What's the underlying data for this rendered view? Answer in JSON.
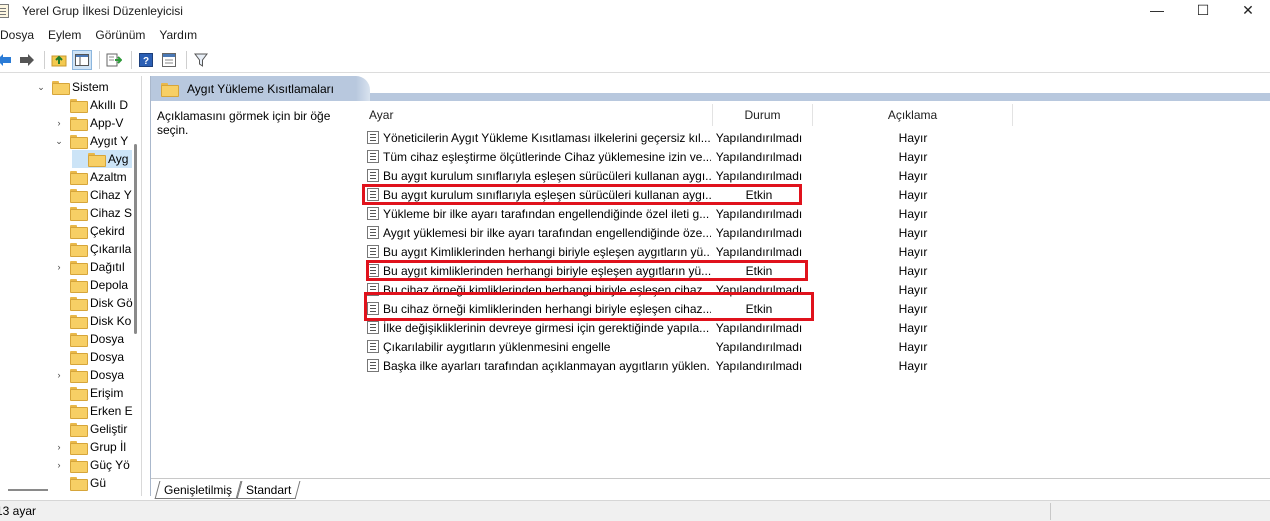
{
  "window": {
    "title": "Yerel Grup İlkesi Düzenleyicisi",
    "controls": {
      "minimize": "—",
      "maximize": "☐",
      "close": "✕"
    }
  },
  "menu": [
    "Dosya",
    "Eylem",
    "Görünüm",
    "Yardım"
  ],
  "toolbar": {
    "icons": [
      "back-arrow-icon",
      "forward-arrow-icon",
      "up-folder-icon",
      "show-hide-tree-icon",
      "export-list-icon",
      "help-icon",
      "filter-icon"
    ]
  },
  "tree": {
    "items": [
      {
        "label": "Sistem",
        "chevron": "expanded"
      },
      {
        "label": "Akıllı D",
        "chevron": "none"
      },
      {
        "label": "App-V",
        "chevron": "collapsed"
      },
      {
        "label": "Aygıt Y",
        "chevron": "expanded"
      },
      {
        "label": "Ayg",
        "chevron": "none",
        "selected": true
      },
      {
        "label": "Azaltm",
        "chevron": "none"
      },
      {
        "label": "Cihaz Y",
        "chevron": "none"
      },
      {
        "label": "Cihaz S",
        "chevron": "none"
      },
      {
        "label": "Çekird",
        "chevron": "none"
      },
      {
        "label": "Çıkarıla",
        "chevron": "none"
      },
      {
        "label": "Dağıtıl",
        "chevron": "collapsed"
      },
      {
        "label": "Depola",
        "chevron": "none"
      },
      {
        "label": "Disk Gö",
        "chevron": "none"
      },
      {
        "label": "Disk Ko",
        "chevron": "none"
      },
      {
        "label": "Dosya",
        "chevron": "none"
      },
      {
        "label": "Dosya",
        "chevron": "none"
      },
      {
        "label": "Dosya",
        "chevron": "collapsed"
      },
      {
        "label": "Erişim",
        "chevron": "none"
      },
      {
        "label": "Erken E",
        "chevron": "none"
      },
      {
        "label": "Geliştir",
        "chevron": "none"
      },
      {
        "label": "Grup İl",
        "chevron": "collapsed"
      },
      {
        "label": "Güç Yö",
        "chevron": "collapsed"
      },
      {
        "label": "Gü",
        "chevron": "none"
      }
    ]
  },
  "pane": {
    "header": "Aygıt Yükleme Kısıtlamaları",
    "description": "Açıklamasını görmek için bir öğe seçin.",
    "columns": {
      "setting": "Ayar",
      "state": "Durum",
      "comment": "Açıklama"
    },
    "rows": [
      {
        "name": "Yöneticilerin Aygıt Yükleme Kısıtlaması ilkelerini geçersiz kıl...",
        "state": "Yapılandırılmadı",
        "comment": "Hayır"
      },
      {
        "name": "Tüm cihaz eşleştirme ölçütlerinde Cihaz yüklemesine izin ve...",
        "state": "Yapılandırılmadı",
        "comment": "Hayır"
      },
      {
        "name": "Bu aygıt kurulum sınıflarıyla eşleşen sürücüleri kullanan aygı...",
        "state": "Yapılandırılmadı",
        "comment": "Hayır"
      },
      {
        "name": "Bu aygıt kurulum sınıflarıyla eşleşen sürücüleri kullanan aygı...",
        "state": "Etkin",
        "comment": "Hayır",
        "highlighted": true
      },
      {
        "name": "Yükleme bir ilke ayarı tarafından engellendiğinde özel ileti g...",
        "state": "Yapılandırılmadı",
        "comment": "Hayır"
      },
      {
        "name": "Aygıt yüklemesi bir ilke ayarı tarafından engellendiğinde öze...",
        "state": "Yapılandırılmadı",
        "comment": "Hayır"
      },
      {
        "name": "Bu aygıt Kimliklerinden herhangi biriyle eşleşen aygıtların yü...",
        "state": "Yapılandırılmadı",
        "comment": "Hayır"
      },
      {
        "name": "Bu aygıt kimliklerinden herhangi biriyle eşleşen aygıtların yü...",
        "state": "Etkin",
        "comment": "Hayır",
        "highlighted": true
      },
      {
        "name": "Bu cihaz örneği kimliklerinden herhangi biriyle eşleşen cihaz...",
        "state": "Yapılandırılmadı",
        "comment": "Hayır"
      },
      {
        "name": "Bu cihaz örneği kimliklerinden herhangi biriyle eşleşen cihaz...",
        "state": "Etkin",
        "comment": "Hayır",
        "highlighted": true
      },
      {
        "name": "İlke değişikliklerinin devreye girmesi için gerektiğinde yapıla...",
        "state": "Yapılandırılmadı",
        "comment": "Hayır"
      },
      {
        "name": "Çıkarılabilir aygıtların yüklenmesini engelle",
        "state": "Yapılandırılmadı",
        "comment": "Hayır"
      },
      {
        "name": "Başka ilke ayarları tarafından açıklanmayan aygıtların yüklen...",
        "state": "Yapılandırılmadı",
        "comment": "Hayır"
      }
    ],
    "highlight_color": "#e0121c",
    "tabs": [
      "Genişletilmiş",
      "Standart"
    ]
  },
  "status": {
    "text": "13 ayar"
  }
}
